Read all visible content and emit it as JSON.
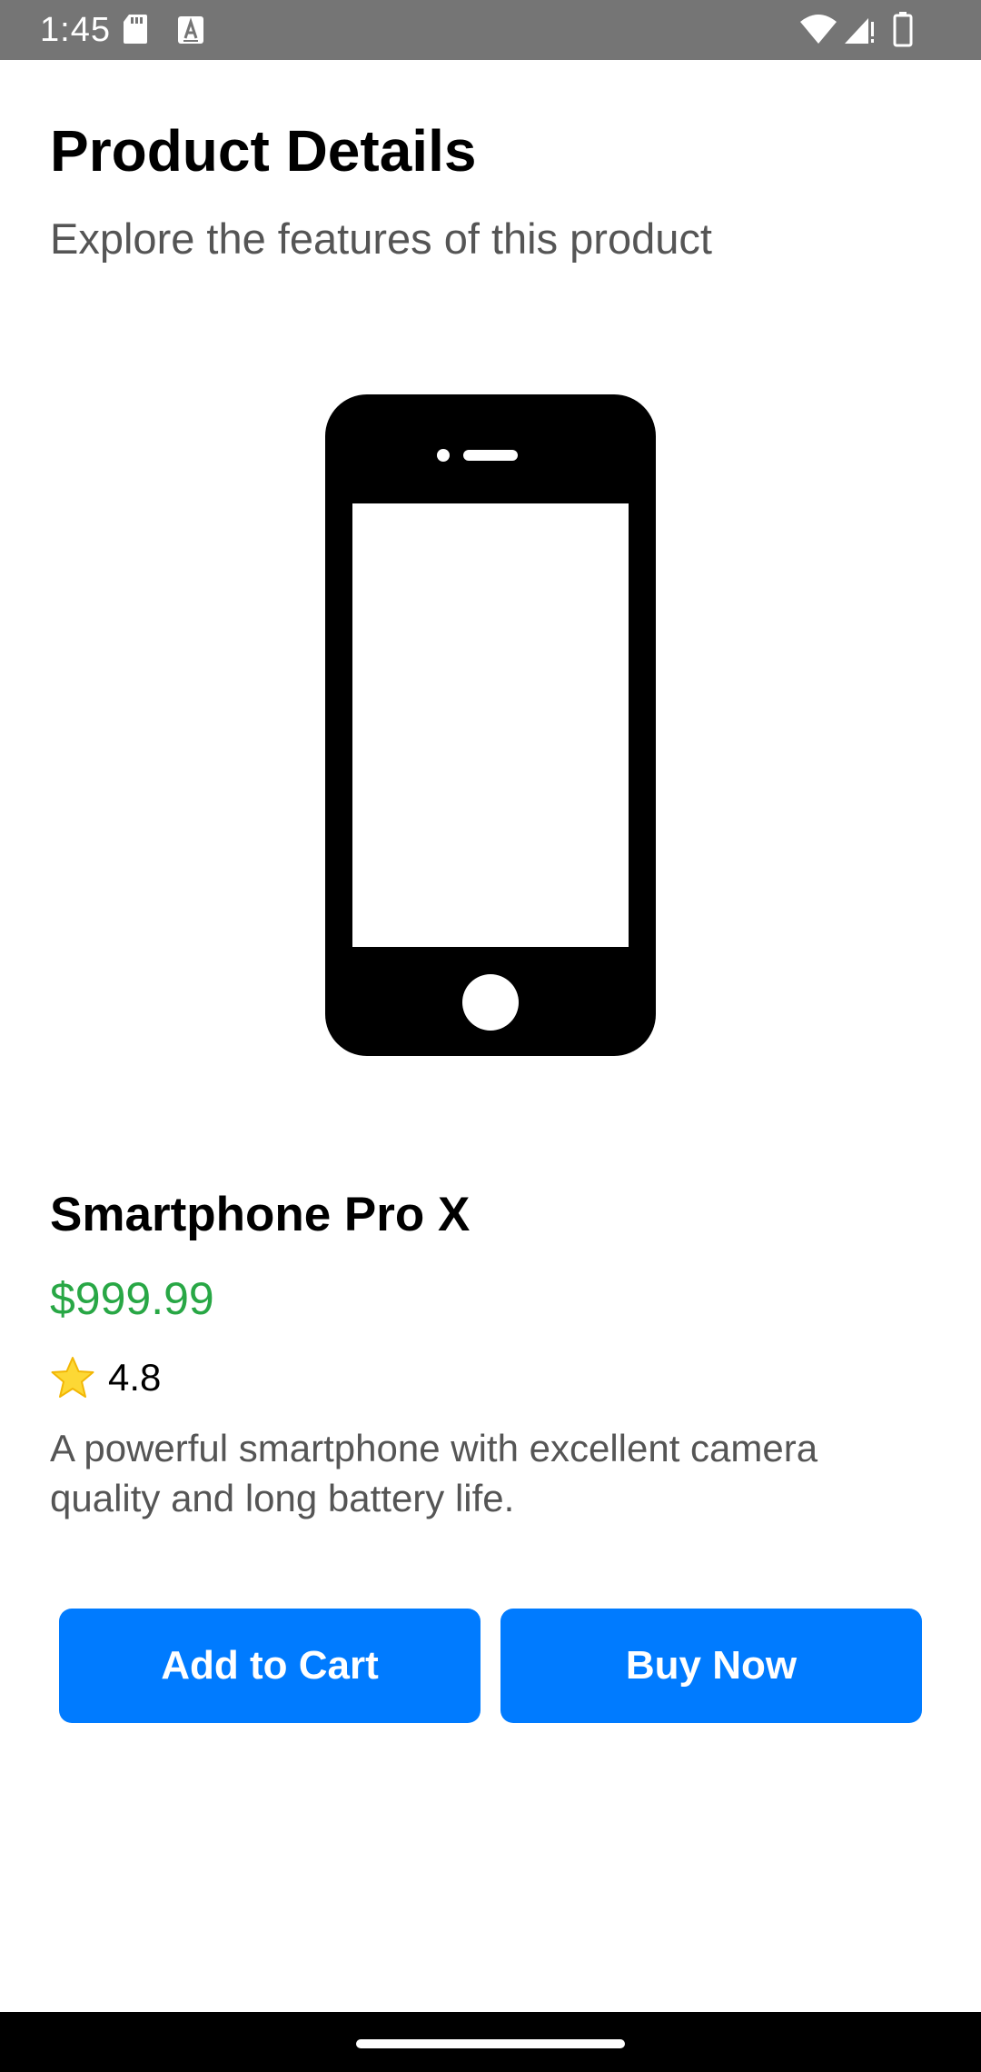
{
  "status_bar": {
    "time": "1:45",
    "icons": [
      "sd-card-icon",
      "a-notification-icon",
      "wifi-icon",
      "signal-icon",
      "battery-icon"
    ]
  },
  "header": {
    "title": "Product Details",
    "subtitle": "Explore the features of this product"
  },
  "product": {
    "image_icon": "smartphone-icon",
    "name": "Smartphone Pro X",
    "price": "$999.99",
    "rating_icon": "star-icon",
    "rating": "4.8",
    "description": "A powerful smartphone with excellent camera quality and long battery life."
  },
  "actions": {
    "add_to_cart_label": "Add to Cart",
    "buy_now_label": "Buy Now"
  },
  "colors": {
    "status_bar": "#757575",
    "price": "#28a745",
    "button": "#007bff",
    "nav_bar": "#000000"
  }
}
